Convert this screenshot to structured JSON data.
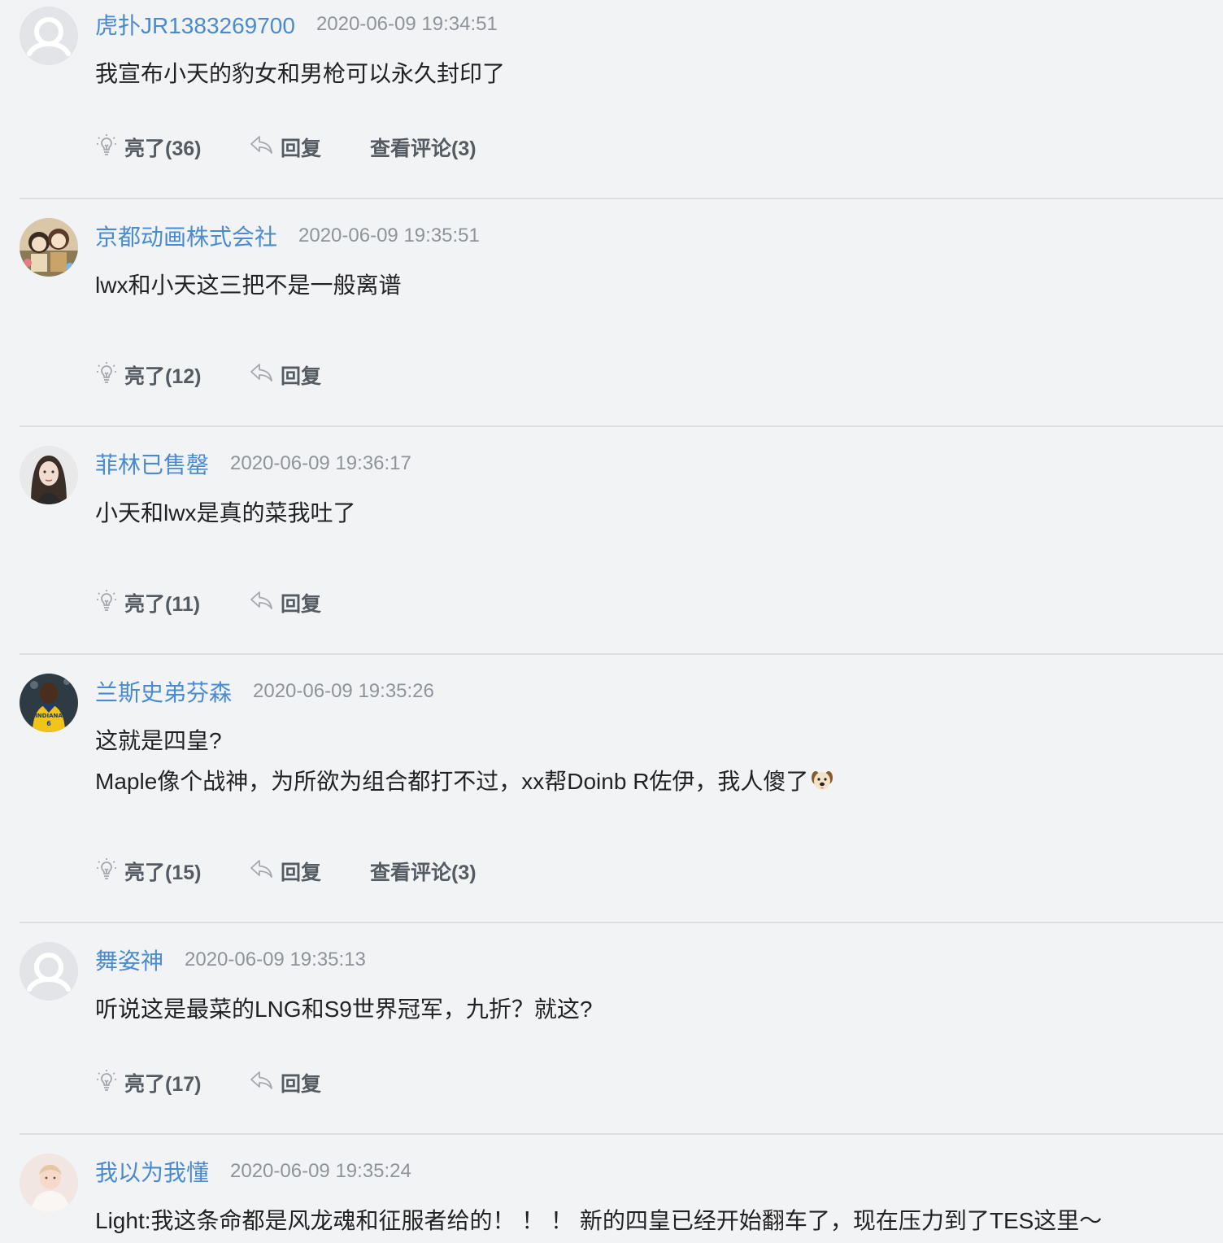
{
  "actions": {
    "like_prefix": "亮了",
    "reply": "回复",
    "view_prefix": "查看评论"
  },
  "colors": {
    "username": "#4a8bd0",
    "timestamp": "#8f949a",
    "body_text": "#222222",
    "action_text": "#555b62",
    "background": "#f2f3f5"
  },
  "comments": [
    {
      "user": "虎扑JR1383269700",
      "time": "2020-06-09 19:34:51",
      "avatar": "default-avatar-icon",
      "lines": [
        "我宣布小天的豹女和男枪可以永久封印了"
      ],
      "likes": "亮了(36)",
      "reply": "回复",
      "view": "查看评论(3)"
    },
    {
      "user": "京都动画株式会社",
      "time": "2020-06-09 19:35:51",
      "avatar": "anime-avatar",
      "lines": [
        "lwx和小天这三把不是一般离谱"
      ],
      "likes": "亮了(12)",
      "reply": "回复",
      "view": ""
    },
    {
      "user": "菲林已售罄",
      "time": "2020-06-09 19:36:17",
      "avatar": "portrait-avatar",
      "lines": [
        "小天和lwx是真的菜我吐了"
      ],
      "likes": "亮了(11)",
      "reply": "回复",
      "view": ""
    },
    {
      "user": "兰斯史弟芬森",
      "time": "2020-06-09 19:35:26",
      "avatar": "basketball-player-avatar",
      "lines": [
        "这就是四皇?",
        "Maple像个战神，为所欲为组合都打不过，xx帮Doinb R佐伊，我人傻了"
      ],
      "emoji": "dog-face-emoji",
      "likes": "亮了(15)",
      "reply": "回复",
      "view": "查看评论(3)"
    },
    {
      "user": "舞姿神",
      "time": "2020-06-09 19:35:13",
      "avatar": "default-avatar-icon",
      "lines": [
        "听说这是最菜的LNG和S9世界冠军，九折？就这?"
      ],
      "likes": "亮了(17)",
      "reply": "回复",
      "view": ""
    },
    {
      "user": "我以为我懂",
      "time": "2020-06-09 19:35:24",
      "avatar": "baby-photo-avatar",
      "lines": [
        "Light:我这条命都是风龙魂和征服者给的！ ！ ！ 新的四皇已经开始翻车了，现在压力到了TES这里～"
      ],
      "likes": "",
      "reply": "",
      "view": ""
    }
  ]
}
